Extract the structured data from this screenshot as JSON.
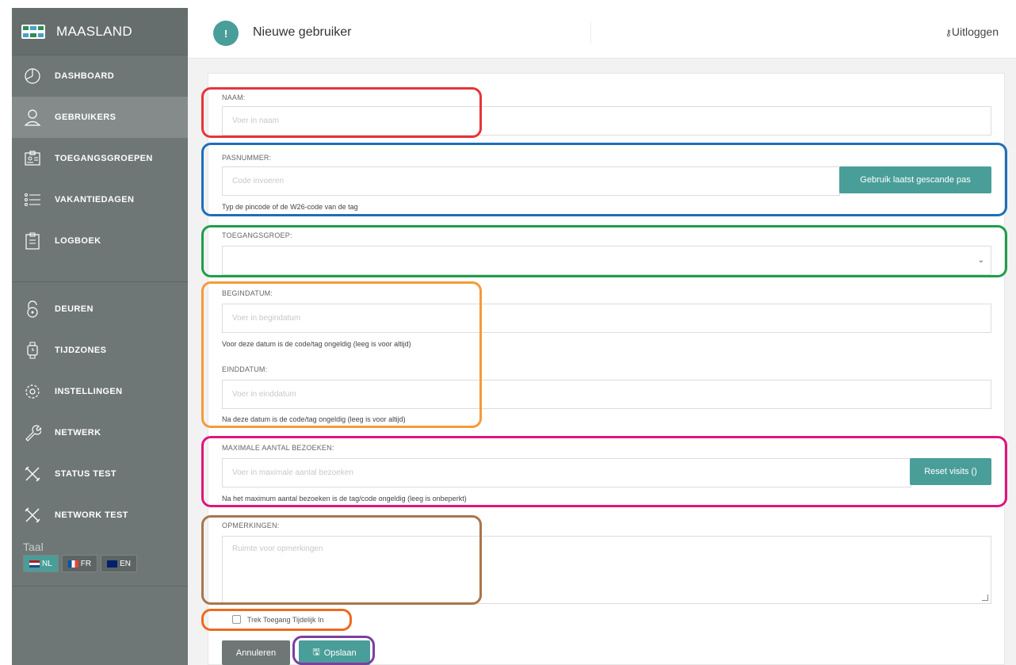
{
  "sidebar": {
    "brand": "MAASLAND",
    "items": [
      {
        "label": "DASHBOARD",
        "icon": "dashboard-icon"
      },
      {
        "label": "GEBRUIKERS",
        "icon": "user-icon",
        "active": true
      },
      {
        "label": "TOEGANGSGROEPEN",
        "icon": "group-icon"
      },
      {
        "label": "VAKANTIEDAGEN",
        "icon": "list-icon"
      },
      {
        "label": "LOGBOEK",
        "icon": "clipboard-icon"
      }
    ],
    "items2": [
      {
        "label": "DEUREN",
        "icon": "lock-icon"
      },
      {
        "label": "TIJDZONES",
        "icon": "watch-icon"
      },
      {
        "label": "INSTELLINGEN",
        "icon": "gear-icon"
      },
      {
        "label": "NETWERK",
        "icon": "wrench-icon"
      },
      {
        "label": "STATUS TEST",
        "icon": "tools-icon"
      },
      {
        "label": "NETWORK TEST",
        "icon": "tools-icon"
      }
    ],
    "lang_label": "Taal",
    "langs": [
      {
        "code": "NL",
        "active": true
      },
      {
        "code": "FR"
      },
      {
        "code": "EN"
      }
    ]
  },
  "header": {
    "icon": "!",
    "title": "Nieuwe gebruiker",
    "logout": "Uitloggen"
  },
  "form": {
    "naam_label": "NAAM:",
    "naam_placeholder": "Voer in  naam",
    "pas_label": "PASNUMMER:",
    "pas_placeholder": "Code invoeren",
    "pas_button": "Gebruik laatst gescande pas",
    "pas_help": "Typ de pincode of de W26-code van de tag",
    "groep_label": "TOEGANGSGROEP:",
    "begin_label": "BEGINDATUM:",
    "begin_placeholder": "Voer in  begindatum",
    "begin_help": "Voor deze datum is de code/tag ongeldig (leeg is voor altijd)",
    "eind_label": "EINDDATUM:",
    "eind_placeholder": "Voer in  einddatum",
    "eind_help": "Na deze datum is de code/tag ongeldig (leeg is voor altijd)",
    "max_label": "MAXIMALE AANTAL BEZOEKEN:",
    "max_placeholder": "Voer in  maximale aantal bezoeken",
    "max_button": "Reset visits ()",
    "max_help": "Na het maximum aantal bezoeken is de tag/code ongeldig (leeg is onbeperkt)",
    "opm_label": "OPMERKINGEN:",
    "opm_placeholder": "Ruimte voor opmerkingen",
    "checkbox_label": "Trek Toegang Tijdelijk In",
    "cancel": "Annuleren",
    "save": "Opslaan"
  },
  "annotation_colors": {
    "red": "#e8343a",
    "blue": "#1e6fb8",
    "green": "#1e9e4a",
    "orange": "#f59a3c",
    "magenta": "#e0147e",
    "brown": "#a9764a",
    "orange2": "#ee6a21",
    "purple": "#7a3fa0"
  }
}
